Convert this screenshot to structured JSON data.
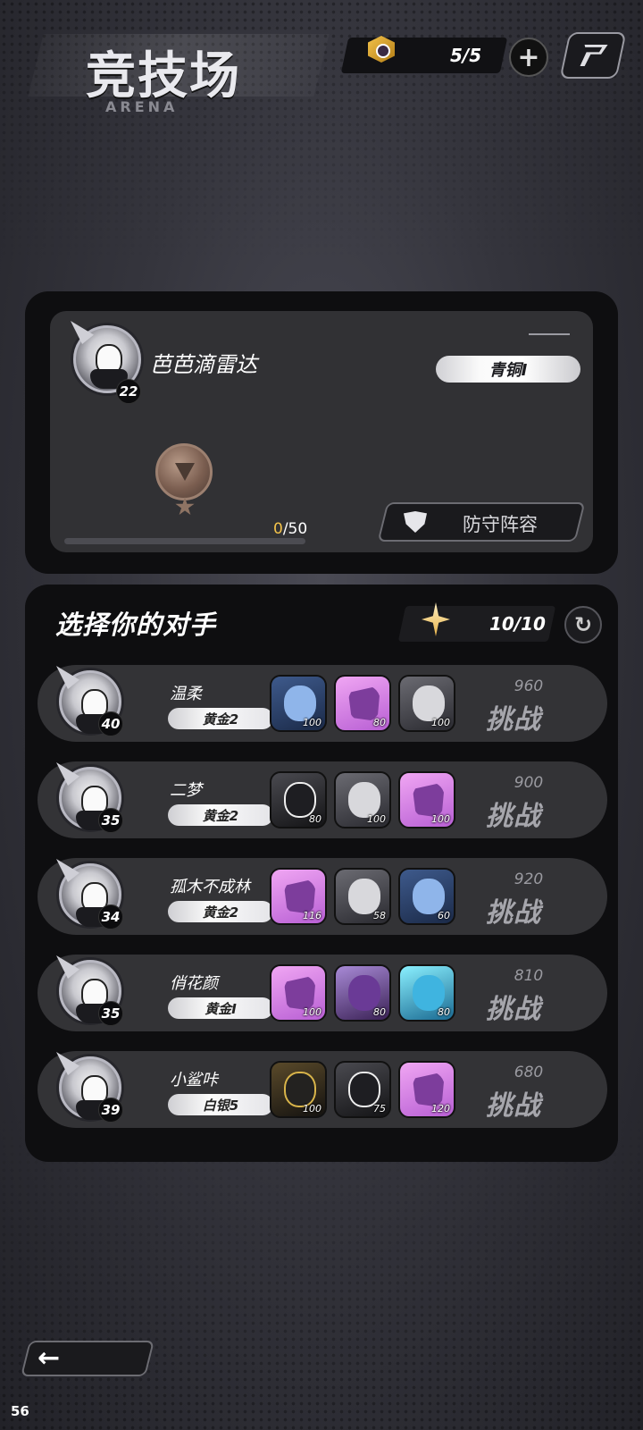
{
  "header": {
    "title": "竞技场",
    "subtitle": "ARENA",
    "tickets": "5/5"
  },
  "player": {
    "name": "芭芭滴雷达",
    "level": "22",
    "rank": "青铜I",
    "points_current": "0",
    "points_max": "/50",
    "progress": 0,
    "defense_label": "防守阵容"
  },
  "opponents_section": {
    "title": "选择你的对手",
    "refresh_count": "10/10"
  },
  "opponents": [
    {
      "name": "温柔",
      "level": "40",
      "rank": "黄金2",
      "score": "960",
      "challenge": "挑战",
      "heroes": [
        {
          "type": "hero-blue",
          "level": "100"
        },
        {
          "type": "hero-pink",
          "level": "80"
        },
        {
          "type": "hero-gray",
          "level": "100"
        }
      ]
    },
    {
      "name": "二梦",
      "level": "35",
      "rank": "黄金2",
      "score": "900",
      "challenge": "挑战",
      "heroes": [
        {
          "type": "hero-dark",
          "level": "80"
        },
        {
          "type": "hero-gray",
          "level": "100"
        },
        {
          "type": "hero-pink",
          "level": "100"
        }
      ]
    },
    {
      "name": "孤木不成林",
      "level": "34",
      "rank": "黄金2",
      "score": "920",
      "challenge": "挑战",
      "heroes": [
        {
          "type": "hero-pink",
          "level": "116"
        },
        {
          "type": "hero-gray",
          "level": "58"
        },
        {
          "type": "hero-blue",
          "level": "60"
        }
      ]
    },
    {
      "name": "俏花颜",
      "level": "35",
      "rank": "黄金I",
      "score": "810",
      "challenge": "挑战",
      "heroes": [
        {
          "type": "hero-pink",
          "level": "100"
        },
        {
          "type": "hero-purple",
          "level": "80"
        },
        {
          "type": "hero-cyan",
          "level": "80"
        }
      ]
    },
    {
      "name": "小鲨咔",
      "level": "39",
      "rank": "白银5",
      "score": "680",
      "challenge": "挑战",
      "heroes": [
        {
          "type": "hero-gold",
          "level": "100"
        },
        {
          "type": "hero-dark",
          "level": "75"
        },
        {
          "type": "hero-pink",
          "level": "120"
        }
      ]
    }
  ],
  "footer": {
    "back_arrow": "←",
    "fps": "56"
  }
}
